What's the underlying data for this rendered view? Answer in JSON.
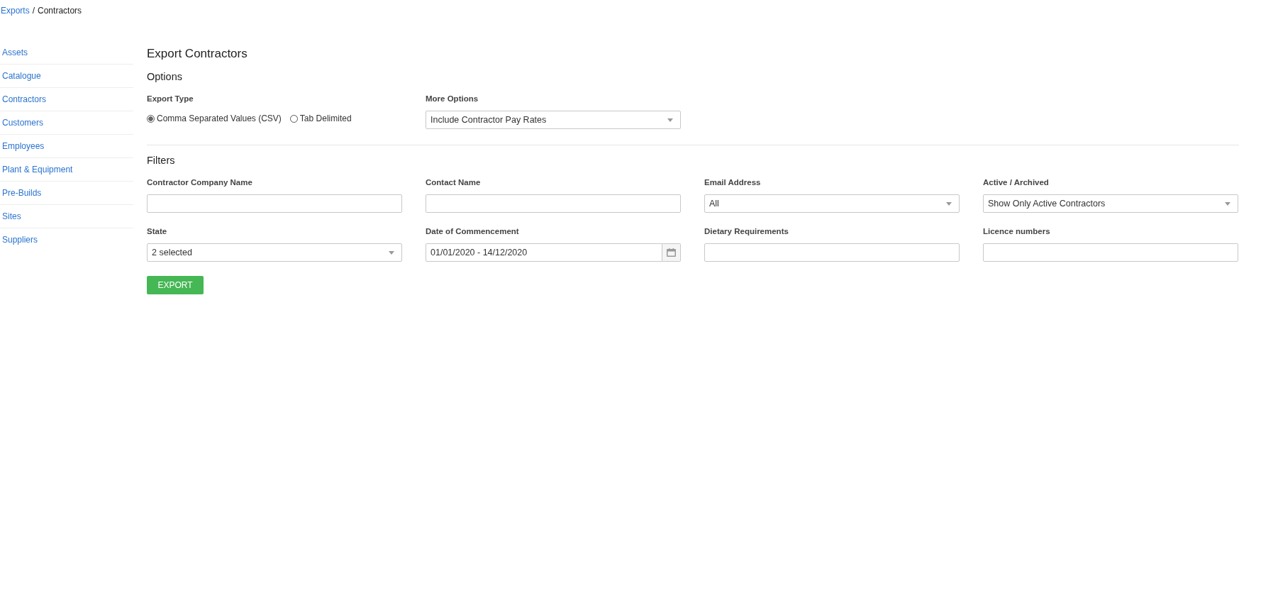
{
  "breadcrumb": {
    "link": "Exports",
    "separator": "/",
    "current": "Contractors"
  },
  "sidebar": {
    "items": [
      {
        "label": "Assets"
      },
      {
        "label": "Catalogue"
      },
      {
        "label": "Contractors"
      },
      {
        "label": "Customers"
      },
      {
        "label": "Employees"
      },
      {
        "label": "Plant & Equipment"
      },
      {
        "label": "Pre-Builds"
      },
      {
        "label": "Sites"
      },
      {
        "label": "Suppliers"
      }
    ]
  },
  "title": "Export Contractors",
  "options": {
    "heading": "Options",
    "export_type": {
      "label": "Export Type",
      "choices": [
        {
          "label": "Comma Separated Values (CSV)",
          "selected": true
        },
        {
          "label": "Tab Delimited",
          "selected": false
        }
      ]
    },
    "more_options": {
      "label": "More Options",
      "value": "Include Contractor Pay Rates"
    }
  },
  "filters": {
    "heading": "Filters",
    "fields": [
      {
        "kind": "text",
        "label": "Contractor Company Name"
      },
      {
        "kind": "text",
        "label": "Contact Name"
      },
      {
        "kind": "select",
        "label": "Email Address",
        "value": "All"
      },
      {
        "kind": "select",
        "label": "Active / Archived",
        "value": "Show Only Active Contractors"
      },
      {
        "kind": "select",
        "label": "State",
        "value": "2 selected"
      },
      {
        "kind": "date",
        "label": "Date of Commencement",
        "value": "01/01/2020 - 14/12/2020"
      },
      {
        "kind": "text",
        "label": "Dietary Requirements"
      },
      {
        "kind": "text",
        "label": "Licence numbers"
      }
    ]
  },
  "export_button": "EXPORT"
}
